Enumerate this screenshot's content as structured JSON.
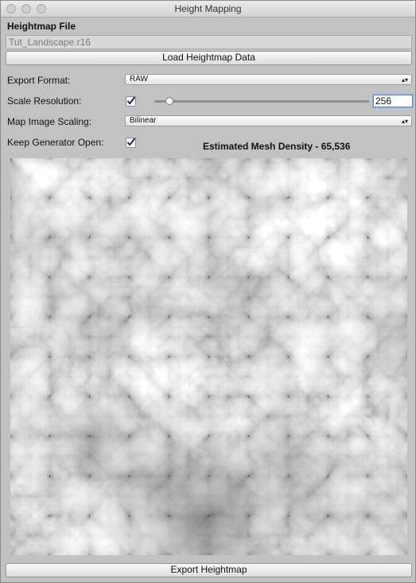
{
  "window": {
    "title": "Height Mapping"
  },
  "heightmap": {
    "section_label": "Heightmap File",
    "file_value": "Tut_Landscape.r16",
    "load_button": "Load Heightmap Data"
  },
  "options": {
    "export_format_label": "Export Format:",
    "export_format_value": "RAW",
    "scale_resolution_label": "Scale Resolution:",
    "scale_resolution_checked": true,
    "scale_resolution_slider_fraction": 0.05,
    "scale_resolution_value": "256",
    "map_scaling_label": "Map Image Scaling:",
    "map_scaling_value": "Bilinear",
    "keep_open_label": "Keep Generator Open:",
    "keep_open_checked": true,
    "mesh_density_text": "Estimated Mesh Density - 65,536"
  },
  "preview": {
    "icon": "heightmap-preview-image"
  },
  "footer": {
    "export_button": "Export Heightmap"
  }
}
